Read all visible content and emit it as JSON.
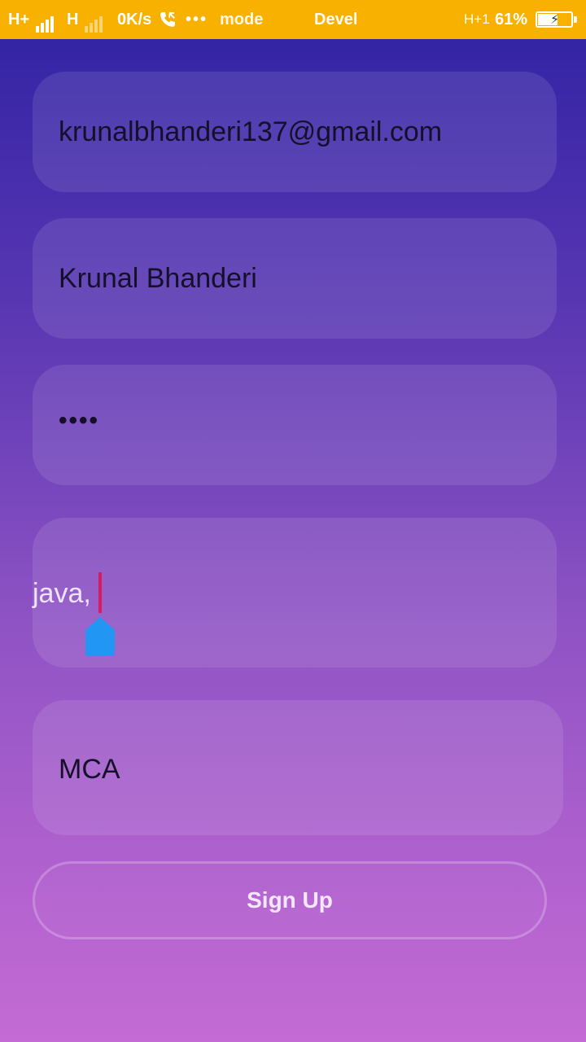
{
  "status_bar": {
    "net1": "H+",
    "net2": "H",
    "speed": "0K/s",
    "dots": "•••",
    "mode": "mode",
    "devel": "Devel",
    "net3": "H+1",
    "battery_percent": "61%",
    "battery_level": 0.61,
    "colors": {
      "background": "#f9b100",
      "text": "#ffffff"
    },
    "icons": [
      "signal-icon",
      "call-icon",
      "battery-charging-icon"
    ]
  },
  "form": {
    "email_value": "krunalbhanderi137@gmail.com",
    "name_value": "Krunal Bhanderi",
    "password_value": "••••",
    "skills_value": "java,",
    "degree_value": "MCA"
  },
  "signup": {
    "label": "Sign Up"
  },
  "colors": {
    "gradient_top": "#2e22a3",
    "gradient_bottom": "#c46bd4",
    "cursor": "#d81b60",
    "cursor_handle": "#2196f3"
  }
}
